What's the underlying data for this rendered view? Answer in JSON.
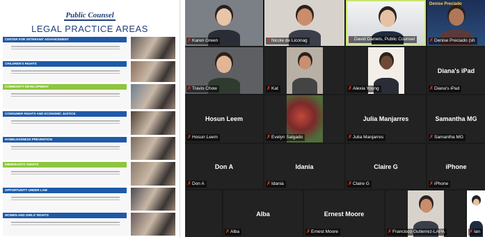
{
  "poster": {
    "logo": "Public Counsel",
    "title": "LEGAL PRACTICE AREAS",
    "areas": [
      {
        "name": "CENTER FOR VETERANS' ADVANCEMENT",
        "color": "#1e5aa8"
      },
      {
        "name": "CHILDREN'S RIGHTS",
        "color": "#1e5aa8"
      },
      {
        "name": "COMMUNITY DEVELOPMENT",
        "color": "#8cc63e"
      },
      {
        "name": "CONSUMER RIGHTS AND ECONOMIC JUSTICE",
        "color": "#1e5aa8"
      },
      {
        "name": "HOMELESSNESS PREVENTION",
        "color": "#1e5aa8"
      },
      {
        "name": "IMMIGRANTS' RIGHTS",
        "color": "#8cc63e"
      },
      {
        "name": "OPPORTUNITY UNDER LAW",
        "color": "#1e5aa8"
      },
      {
        "name": "WOMEN AND GIRLS' RIGHTS",
        "color": "#1e5aa8"
      }
    ]
  },
  "gallery": {
    "tiles": [
      {
        "label": "Karen Green",
        "kind": "video"
      },
      {
        "label": "Nicole de Liconag",
        "kind": "video"
      },
      {
        "label": "David Daniels, Public Counsel",
        "kind": "video",
        "active": true
      },
      {
        "label": "Denise Preciado (sh",
        "kind": "video",
        "overlay": "Denise Preciado"
      },
      {
        "label": "Travis Chow",
        "kind": "video"
      },
      {
        "label": "Kat",
        "kind": "video"
      },
      {
        "label": "Alexia Young",
        "kind": "video"
      },
      {
        "label": "Diana's iPad",
        "kind": "name",
        "center": "Diana's iPad"
      },
      {
        "label": "Hosun Leem",
        "kind": "name",
        "center": "Hosun Leem"
      },
      {
        "label": "Evelyn Salgado",
        "kind": "video"
      },
      {
        "label": "Julia Manjarres",
        "kind": "name",
        "center": "Julia Manjarres"
      },
      {
        "label": "Samantha MG",
        "kind": "name",
        "center": "Samantha MG"
      },
      {
        "label": "Don A",
        "kind": "name",
        "center": "Don A"
      },
      {
        "label": "Idania",
        "kind": "name",
        "center": "Idania"
      },
      {
        "label": "Claire G",
        "kind": "name",
        "center": "Claire G"
      },
      {
        "label": "iPhone",
        "kind": "name",
        "center": "iPhone"
      },
      {
        "label": "",
        "kind": "empty"
      },
      {
        "label": "Alba",
        "kind": "name",
        "center": "Alba"
      },
      {
        "label": "Ernest Moore",
        "kind": "name",
        "center": "Ernest Moore"
      },
      {
        "label": "Francisco Gutierrez-LAPA",
        "kind": "video"
      },
      {
        "label": "Ian",
        "kind": "partial"
      }
    ]
  }
}
